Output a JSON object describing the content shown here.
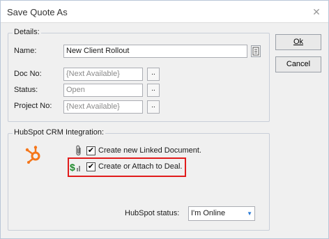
{
  "window": {
    "title": "Save Quote As"
  },
  "details": {
    "group_label": "Details:",
    "name_label": "Name:",
    "name_value": "New Client Rollout",
    "doc_no_label": "Doc No:",
    "doc_no_value": "{Next Available}",
    "status_label": "Status:",
    "status_value": "Open",
    "project_no_label": "Project No:",
    "project_no_value": "{Next Available}",
    "browse_label": ".."
  },
  "buttons": {
    "ok_label": "Ok",
    "cancel_label": "Cancel"
  },
  "hubspot": {
    "group_label": "HubSpot CRM Integration:",
    "create_linked_label": "Create new Linked Document.",
    "create_linked_checked": true,
    "attach_deal_label": "Create or Attach to Deal.",
    "attach_deal_checked": true,
    "status_label": "HubSpot status:",
    "status_value": "I'm Online",
    "accent": "#f5761a"
  }
}
